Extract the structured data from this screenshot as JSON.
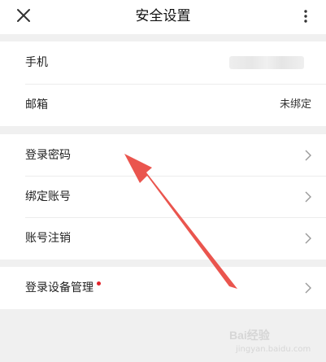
{
  "header": {
    "title": "安全设置"
  },
  "account_group": {
    "items": [
      {
        "label": "手机",
        "value": ""
      },
      {
        "label": "邮箱",
        "value": "未绑定"
      }
    ]
  },
  "security_group": {
    "items": [
      {
        "label": "登录密码"
      },
      {
        "label": "绑定账号"
      },
      {
        "label": "账号注销"
      }
    ]
  },
  "device_group": {
    "items": [
      {
        "label": "登录设备管理",
        "has_notification_dot": true
      }
    ]
  },
  "annotation": {
    "arrow_color": "#e8463f"
  },
  "watermark": {
    "logo_text": "Bai经验",
    "sub_text": "jingyan.baidu.com"
  },
  "colors": {
    "background": "#f0f0f0",
    "notification_dot": "#e3242b"
  }
}
